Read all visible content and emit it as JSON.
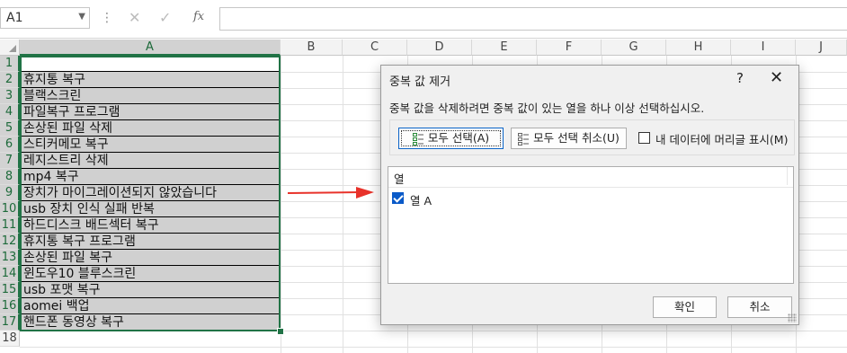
{
  "formula_bar": {
    "name_box": "A1",
    "fx_label": "fx",
    "formula_value": ""
  },
  "sheet": {
    "columns": [
      "A",
      "B",
      "C",
      "D",
      "E",
      "F",
      "G",
      "H",
      "I",
      "J"
    ],
    "rows": [
      "1",
      "2",
      "3",
      "4",
      "5",
      "6",
      "7",
      "8",
      "9",
      "10",
      "11",
      "12",
      "13",
      "14",
      "15",
      "16",
      "17",
      "18"
    ],
    "column_a": [
      "",
      "휴지통 복구",
      "블랙스크린",
      "파일복구 프로그램",
      "손상된 파일 삭제",
      "스티커메모 복구",
      "레지스트리 삭제",
      "mp4 복구",
      "장치가 마이그레이션되지 않았습니다",
      "usb 장치 인식 실패 반복",
      "하드디스크 배드섹터 복구",
      "휴지통 복구 프로그램",
      "손상된 파일 복구",
      "윈도우10 블루스크린",
      "usb 포맷 복구",
      "aomei 백업",
      "핸드폰 동영상 복구",
      ""
    ]
  },
  "dialog": {
    "title": "중복 값 제거",
    "help": "?",
    "close": "✕",
    "description": "중복 값을 삭제하려면 중복 값이 있는 열을 하나 이상 선택하십시오.",
    "select_all_button": "모두 선택(A)",
    "unselect_all_button": "모두 선택 취소(U)",
    "my_data_has_headers_label": "내 데이터에 머리글 표시(M)",
    "my_data_has_headers_checked": false,
    "list_header": "열",
    "columns": [
      {
        "label": "열 A",
        "checked": true
      }
    ],
    "ok_button": "확인",
    "cancel_button": "취소"
  },
  "colors": {
    "excel_green": "#217346",
    "selection_fill": "#d0d0d0",
    "arrow_red": "#e8322a",
    "check_blue": "#0a5ac8"
  }
}
